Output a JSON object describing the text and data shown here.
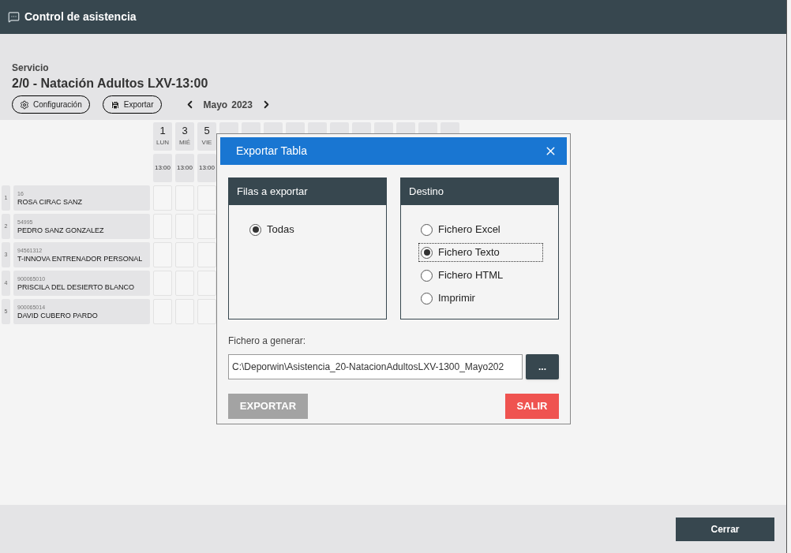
{
  "window": {
    "title": "Control de asistencia"
  },
  "service": {
    "label": "Servicio",
    "name": "2/0 - Natación Adultos LXV-13:00"
  },
  "toolbar": {
    "buttons": [
      {
        "label": "Configuración",
        "kind": "settings"
      },
      {
        "label": "Exportar",
        "kind": "save"
      }
    ],
    "month": "Mayo",
    "year": "2023"
  },
  "days": [
    {
      "day": "1",
      "weekday": "LUN",
      "time": "13:00"
    },
    {
      "day": "3",
      "weekday": "MIÉ",
      "time": "13:00"
    },
    {
      "day": "5",
      "weekday": "VIE",
      "time": "13:00"
    }
  ],
  "rows": [
    {
      "index": "1",
      "code": "16",
      "name": "ROSA CIRAC SANZ"
    },
    {
      "index": "2",
      "code": "54995",
      "name": "PEDRO SANZ GONZALEZ"
    },
    {
      "index": "3",
      "code": "94561312",
      "name": "T-INNOVA ENTRENADOR PERSONAL"
    },
    {
      "index": "4",
      "code": "900065010",
      "name": "PRISCILA DEL DESIERTO BLANCO"
    },
    {
      "index": "5",
      "code": "900065014",
      "name": "DAVID CUBERO PARDO"
    }
  ],
  "dialog": {
    "title": "Exportar Tabla",
    "rows_panel": {
      "title": "Filas a exportar",
      "options": [
        {
          "label": "Todas",
          "selected": true,
          "focused": false
        }
      ]
    },
    "destination_panel": {
      "title": "Destino",
      "options": [
        {
          "label": "Fichero Excel",
          "selected": false,
          "focused": false
        },
        {
          "label": "Fichero Texto",
          "selected": true,
          "focused": true
        },
        {
          "label": "Fichero HTML",
          "selected": false,
          "focused": false
        },
        {
          "label": "Imprimir",
          "selected": false,
          "focused": false
        }
      ]
    },
    "file_label": "Fichero a generar:",
    "file_value": "C:\\Deporwin\\Asistencia_20-NatacionAdultosLXV-1300_Mayo202",
    "browse_button": "...",
    "export_button": {
      "label": "EXPORTAR",
      "disabled": true
    },
    "exit_button": "SALIR"
  },
  "footer": {
    "close_button": "Cerrar"
  }
}
